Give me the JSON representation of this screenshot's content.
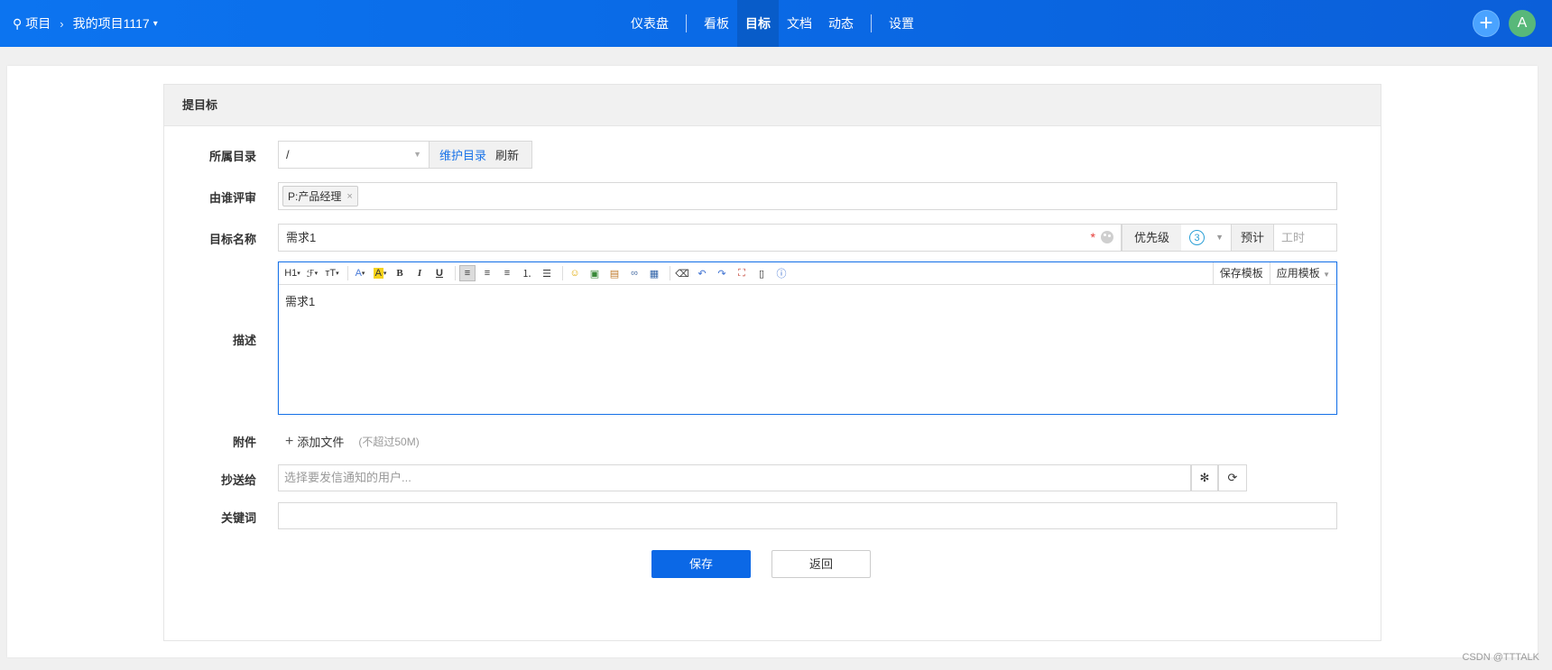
{
  "header": {
    "project_label": "项目",
    "project_name": "我的项目1117",
    "nav": {
      "dashboard": "仪表盘",
      "kanban": "看板",
      "goals": "目标",
      "docs": "文档",
      "activity": "动态",
      "settings": "设置"
    },
    "avatar_letter": "A"
  },
  "form": {
    "panel_title": "提目标",
    "directory": {
      "label": "所属目录",
      "value": "/",
      "maintain_link": "维护目录",
      "refresh_link": "刷新"
    },
    "reviewer": {
      "label": "由谁评审",
      "tag": "P:产品经理"
    },
    "goal_name": {
      "label": "目标名称",
      "value": "需求1",
      "required_mark": "*"
    },
    "priority": {
      "label": "优先级",
      "value": "3"
    },
    "estimate": {
      "label": "预计",
      "placeholder": "工时"
    },
    "description": {
      "label": "描述",
      "content": "需求1",
      "toolbar": {
        "heading": "H1",
        "font_family": "ℱ",
        "font_size": "ᴛT",
        "font_color": "A",
        "bg_color": "A",
        "bold": "B",
        "italic": "I",
        "underline": "U",
        "save_template": "保存模板",
        "apply_template": "应用模板"
      }
    },
    "attachment": {
      "label": "附件",
      "add_file": "添加文件",
      "hint": "(不超过50M)"
    },
    "cc": {
      "label": "抄送给",
      "placeholder": "选择要发信通知的用户..."
    },
    "keywords": {
      "label": "关键词",
      "value": ""
    },
    "save_button": "保存",
    "back_button": "返回"
  },
  "watermark": "CSDN @TTTALK",
  "colors": {
    "primary": "#0b68e6",
    "header": "#0a6ae6",
    "required": "#e53935",
    "priority": "#2a9fd6",
    "avatar": "#58b87a"
  }
}
